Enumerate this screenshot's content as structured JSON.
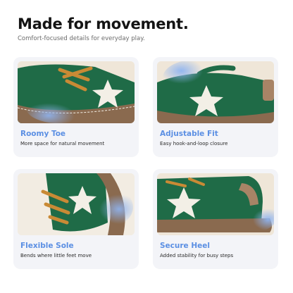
{
  "header": {
    "title": "Made for movement.",
    "subtitle": "Comfort-focused details for everyday play."
  },
  "features": [
    {
      "title": "Roomy Toe",
      "description": "More space for natural movement",
      "highlight_color": "#5b8fe3"
    },
    {
      "title": "Adjustable Fit",
      "description": "Easy hook-and-loop closure",
      "highlight_color": "#5b8fe3"
    },
    {
      "title": "Flexible Sole",
      "description": "Bends where little feet move",
      "highlight_color": "#5b8fe3"
    },
    {
      "title": "Secure Heel",
      "description": "Added stability for busy steps",
      "highlight_color": "#5b8fe3"
    }
  ],
  "colors": {
    "shoe_green": "#1f6b47",
    "sole_brown": "#8a6a4f",
    "lace_orange": "#c98a35",
    "star_white": "#f3efe6",
    "card_bg": "#f3f4f8"
  }
}
